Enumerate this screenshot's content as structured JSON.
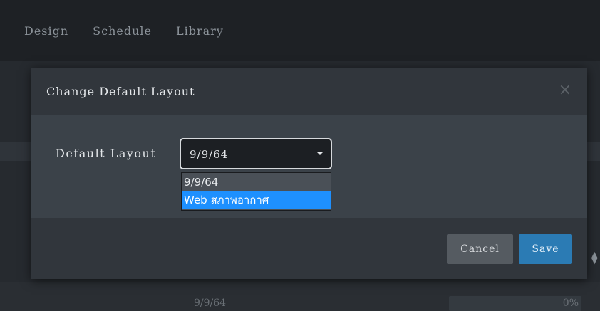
{
  "nav": {
    "items": [
      "Design",
      "Schedule",
      "Library"
    ]
  },
  "background": {
    "row_name": "9/9/64",
    "row_value": "0%"
  },
  "modal": {
    "title": "Change Default Layout",
    "close_glyph": "×",
    "field_label": "Default Layout",
    "select_value": "9/9/64",
    "options": [
      "9/9/64",
      "Web สภาพอากาศ"
    ],
    "highlighted_option_index": 1,
    "cancel_label": "Cancel",
    "save_label": "Save"
  },
  "colors": {
    "accent": "#2b7bb4",
    "option_highlight": "#1e90ff",
    "background": "#262a2f"
  },
  "icons": {
    "close": "close-icon",
    "caret": "chevron-down-icon",
    "sort": "sort-icon"
  }
}
